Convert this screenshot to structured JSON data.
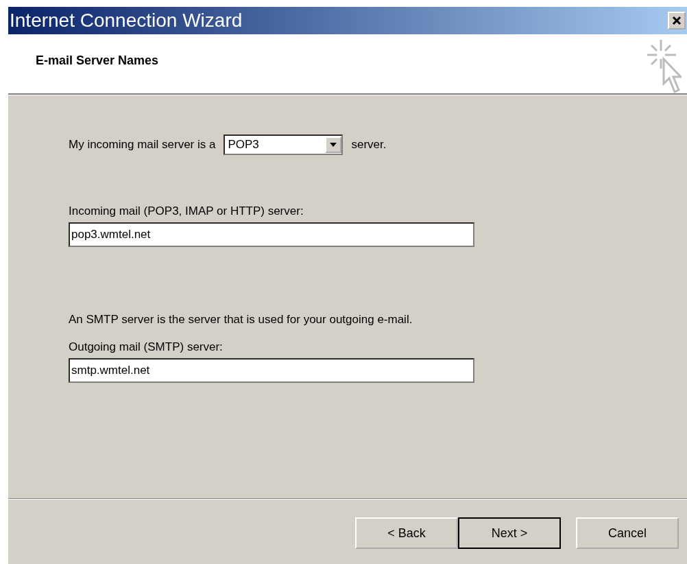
{
  "window": {
    "title": "Internet Connection Wizard"
  },
  "header": {
    "title": "E-mail Server Names"
  },
  "server_type": {
    "label": "My incoming mail server is a",
    "value": "POP3",
    "suffix": "server."
  },
  "incoming": {
    "label": "Incoming mail (POP3, IMAP or HTTP) server:",
    "value": "pop3.wmtel.net"
  },
  "smtp_note": "An SMTP server is the server that is used for your outgoing e-mail.",
  "outgoing": {
    "label": "Outgoing mail (SMTP) server:",
    "value": "smtp.wmtel.net"
  },
  "buttons": [
    {
      "label": "< Back",
      "default": false
    },
    {
      "label": "Next >",
      "default": true
    },
    {
      "label": "Cancel",
      "default": false
    }
  ]
}
